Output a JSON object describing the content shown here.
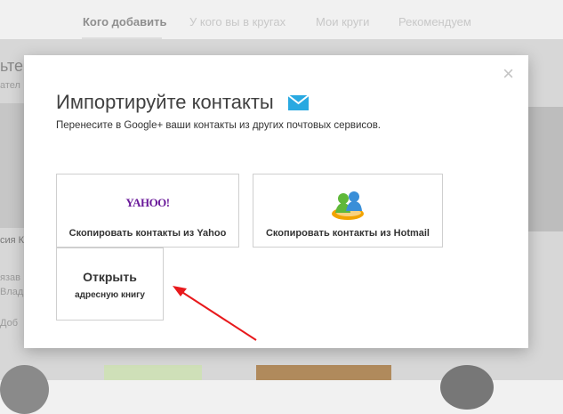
{
  "tabs": [
    {
      "label": "Кого добавить"
    },
    {
      "label": "У кого вы в кругах"
    },
    {
      "label": "Мои круги"
    },
    {
      "label": "Рекомендуем"
    }
  ],
  "background": {
    "heading": "ьте",
    "subtext": "ател",
    "person_name": "сия К",
    "line1": "язав",
    "line2": "Влад",
    "add_label": "Доб"
  },
  "modal": {
    "title": "Импортируйте контакты",
    "subtitle": "Перенесите в Google+ ваши контакты из других почтовых сервисов.",
    "close_symbol": "×",
    "yahoo": {
      "logo_text": "YAHOO!",
      "label": "Скопировать контакты из Yahoo"
    },
    "hotmail": {
      "label": "Скопировать контакты из Hotmail"
    },
    "address_book": {
      "title": "Открыть",
      "subtitle": "адресную книгу"
    }
  },
  "colors": {
    "mail_icon": "#29a9e1",
    "arrow": "#e8191c",
    "yahoo": "#6a1a9a"
  },
  "icons": [
    "mail-icon",
    "yahoo-logo",
    "msn-messenger-icon",
    "close-icon"
  ]
}
